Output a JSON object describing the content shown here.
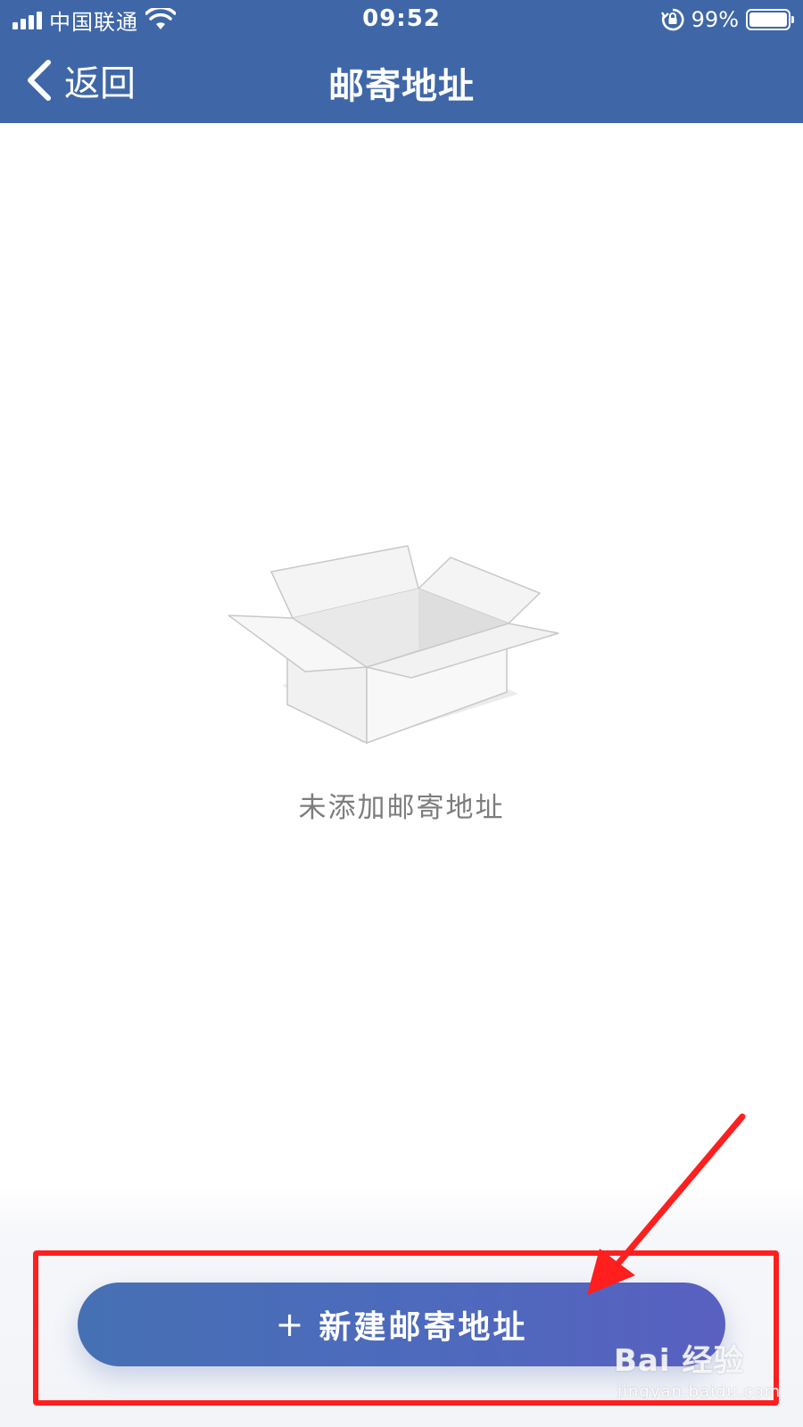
{
  "status_bar": {
    "carrier": "中国联通",
    "time": "09:52",
    "battery_percent": "99%",
    "battery_level": 0.99,
    "icons": [
      "signal-icon",
      "wifi-icon",
      "rotation-lock-icon",
      "battery-icon"
    ]
  },
  "navbar": {
    "back_label": "返回",
    "title": "邮寄地址",
    "background_color": "#3f67a8"
  },
  "empty_state": {
    "illustration": "open-box-icon",
    "message": "未添加邮寄地址"
  },
  "footer": {
    "add_button_plus": "+",
    "add_button_label": "新建邮寄地址"
  },
  "annotation": {
    "color": "#ff1f1f",
    "type": "highlight-box-with-arrow"
  },
  "watermark": {
    "line1": "Bai 经验",
    "line2": "jingyan.baidu.com"
  }
}
